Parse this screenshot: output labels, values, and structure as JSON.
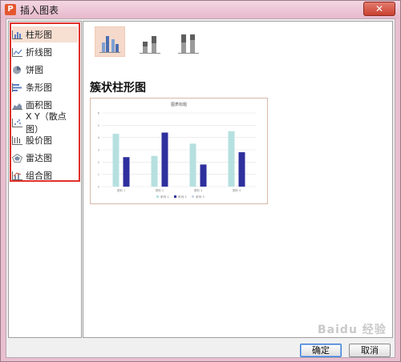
{
  "window": {
    "title": "插入图表",
    "close_label": "✕"
  },
  "sidebar": {
    "items": [
      {
        "label": "柱形图",
        "icon": "column-chart-icon",
        "selected": true
      },
      {
        "label": "折线图",
        "icon": "line-chart-icon",
        "selected": false
      },
      {
        "label": "饼图",
        "icon": "pie-chart-icon",
        "selected": false
      },
      {
        "label": "条形图",
        "icon": "bar-chart-icon",
        "selected": false
      },
      {
        "label": "面积图",
        "icon": "area-chart-icon",
        "selected": false
      },
      {
        "label": "X Y（散点图）",
        "icon": "scatter-chart-icon",
        "selected": false
      },
      {
        "label": "股价图",
        "icon": "stock-chart-icon",
        "selected": false
      },
      {
        "label": "雷达图",
        "icon": "radar-chart-icon",
        "selected": false
      },
      {
        "label": "组合图",
        "icon": "combo-chart-icon",
        "selected": false
      }
    ]
  },
  "main": {
    "subtypes": [
      {
        "name": "clustered-column",
        "selected": true
      },
      {
        "name": "stacked-column",
        "selected": false
      },
      {
        "name": "percent-stacked-column",
        "selected": false
      }
    ],
    "heading": "簇状柱形图"
  },
  "footer": {
    "ok_label": "确定",
    "cancel_label": "取消"
  },
  "watermark": "Baidu 经验",
  "colors": {
    "series1": "#b6e0e0",
    "series2": "#2f2f9e",
    "selected_bg": "#f5d9cb",
    "highlight_border": "#e0312b"
  },
  "chart_data": {
    "type": "bar",
    "title": "图表标题",
    "categories": [
      "类别 1",
      "类别 2",
      "类别 3",
      "类别 4"
    ],
    "series": [
      {
        "name": "系列 1",
        "values": [
          4.3,
          2.5,
          3.5,
          4.5
        ],
        "color": "#b6e0e0"
      },
      {
        "name": "系列 2",
        "values": [
          2.4,
          4.4,
          1.8,
          2.8
        ],
        "color": "#2f2f9e"
      },
      {
        "name": "系列 3",
        "values": [
          0,
          0,
          0,
          0
        ],
        "color": "#cfd6e6"
      }
    ],
    "yticks": [
      "0",
      "1",
      "2",
      "3",
      "4",
      "5",
      "6"
    ],
    "ylim": [
      0,
      6
    ],
    "legend": "bottom",
    "grid": true
  }
}
